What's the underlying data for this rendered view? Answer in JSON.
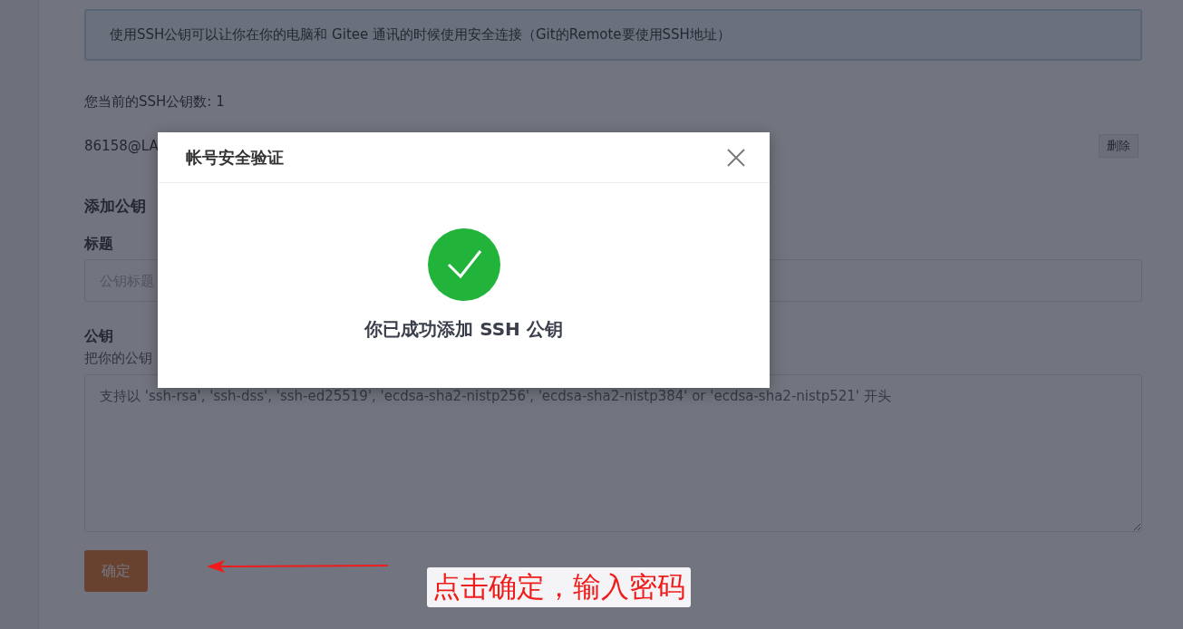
{
  "notice": "使用SSH公钥可以让你在你的电脑和 Gitee 通讯的时候使用安全连接（Git的Remote要使用SSH地址）",
  "key_count": "您当前的SSH公钥数: 1",
  "keys": [
    {
      "name": "86158@LA",
      "delete_button": "删除"
    }
  ],
  "add_key": {
    "heading": "添加公钥",
    "title_label": "标题",
    "title_placeholder": "公钥标题",
    "key_label": "公钥",
    "key_hint": "把你的公钥",
    "key_placeholder": "支持以 'ssh-rsa', 'ssh-dss', 'ssh-ed25519', 'ecdsa-sha2-nistp256', 'ecdsa-sha2-nistp384' or 'ecdsa-sha2-nistp521' 开头",
    "submit": "确定"
  },
  "dialog": {
    "title": "帐号安全验证",
    "message": "你已成功添加 SSH 公钥"
  },
  "annotation": {
    "text": "点击确定，输入密码"
  }
}
